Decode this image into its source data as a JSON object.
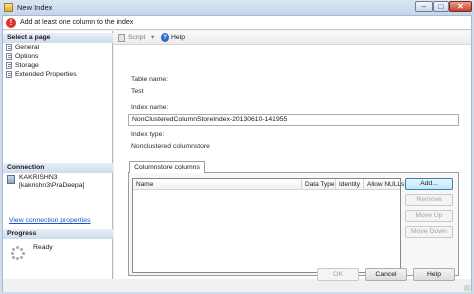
{
  "window": {
    "title": "New Index",
    "minimize_glyph": "–",
    "maximize_glyph": "□",
    "close_glyph": "✕"
  },
  "error": {
    "icon": "error-icon",
    "icon_glyph": "!",
    "message": "Add at least one column to the index"
  },
  "left": {
    "select_header": "Select a page",
    "pages": [
      "General",
      "Options",
      "Storage",
      "Extended Properties"
    ],
    "connection_header": "Connection",
    "connection_server": "KAKRISHN3",
    "connection_user": "[kakrishn3\\PraDeepa]",
    "view_connection_link": "View connection properties",
    "progress_header": "Progress",
    "progress_status": "Ready"
  },
  "toolbar": {
    "script_label": "Script",
    "dropdown_glyph": "▾",
    "help_label": "Help",
    "help_glyph": "?"
  },
  "form": {
    "table_name_label": "Table name:",
    "table_name_value": "Test",
    "index_name_label": "Index name:",
    "index_name_value": "NonClusteredColumnStoreIndex-20130610-141955",
    "index_type_label": "Index type:",
    "index_type_value": "Nonclustered columnstore"
  },
  "columns_tab": {
    "tab_label": "Columnstore columns",
    "headers": [
      "Name",
      "Data Type",
      "Identity",
      "Allow NULLs"
    ],
    "rows": []
  },
  "side_buttons": {
    "add": "Add...",
    "remove": "Remove",
    "move_up": "Move Up",
    "move_down": "Move Down"
  },
  "footer": {
    "ok": "OK",
    "cancel": "Cancel",
    "help": "Help"
  }
}
